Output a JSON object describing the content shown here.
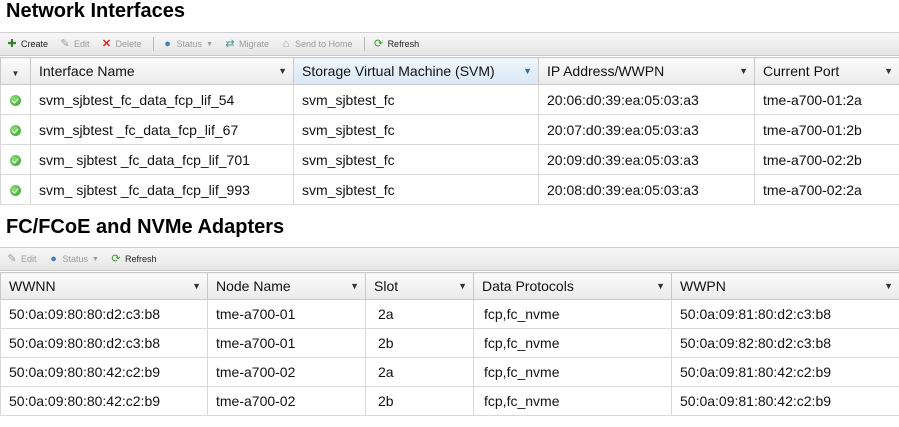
{
  "network_interfaces": {
    "title": "Network Interfaces",
    "toolbar": {
      "create": "Create",
      "edit": "Edit",
      "delete": "Delete",
      "status": "Status",
      "migrate": "Migrate",
      "send_to_home": "Send to Home",
      "refresh": "Refresh"
    },
    "columns": {
      "interface_name": "Interface Name",
      "svm": "Storage Virtual Machine (SVM)",
      "ip_wwpn": "IP Address/WWPN",
      "current_port": "Current Port"
    },
    "rows": [
      {
        "name": "svm_sjbtest_fc_data_fcp_lif_54",
        "svm": "svm_sjbtest_fc",
        "wwpn": "20:06:d0:39:ea:05:03:a3",
        "port": "tme-a700-01:2a"
      },
      {
        "name": "svm_sjbtest _fc_data_fcp_lif_67",
        "svm": "svm_sjbtest_fc",
        "wwpn": "20:07:d0:39:ea:05:03:a3",
        "port": "tme-a700-01:2b"
      },
      {
        "name": "svm_ sjbtest _fc_data_fcp_lif_701",
        "svm": "svm_sjbtest_fc",
        "wwpn": "20:09:d0:39:ea:05:03:a3",
        "port": "tme-a700-02:2b"
      },
      {
        "name": "svm_ sjbtest _fc_data_fcp_lif_993",
        "svm": "svm_sjbtest_fc",
        "wwpn": "20:08:d0:39:ea:05:03:a3",
        "port": "tme-a700-02:2a"
      }
    ]
  },
  "adapters": {
    "title": "FC/FCoE and NVMe Adapters",
    "toolbar": {
      "edit": "Edit",
      "status": "Status",
      "refresh": "Refresh"
    },
    "columns": {
      "wwnn": "WWNN",
      "node_name": "Node Name",
      "slot": "Slot",
      "data_protocols": "Data Protocols",
      "wwpn": "WWPN"
    },
    "rows": [
      {
        "wwnn": "50:0a:09:80:80:d2:c3:b8",
        "node": "tme-a700-01",
        "slot": "2a",
        "protocols": "fcp,fc_nvme",
        "wwpn": "50:0a:09:81:80:d2:c3:b8"
      },
      {
        "wwnn": "50:0a:09:80:80:d2:c3:b8",
        "node": "tme-a700-01",
        "slot": "2b",
        "protocols": "fcp,fc_nvme",
        "wwpn": "50:0a:09:82:80:d2:c3:b8"
      },
      {
        "wwnn": "50:0a:09:80:80:42:c2:b9",
        "node": "tme-a700-02",
        "slot": "2a",
        "protocols": "fcp,fc_nvme",
        "wwpn": "50:0a:09:81:80:42:c2:b9"
      },
      {
        "wwnn": "50:0a:09:80:80:42:c2:b9",
        "node": "tme-a700-02",
        "slot": "2b",
        "protocols": "fcp,fc_nvme",
        "wwpn": "50:0a:09:81:80:42:c2:b9"
      }
    ]
  },
  "icons": {
    "filter": "filter-icon",
    "status_ok": "status-ok-icon"
  },
  "colors": {
    "ok_green": "#3aa52a",
    "selected_header": "#d9e8f7",
    "toolbar_bg": "#ececec"
  }
}
